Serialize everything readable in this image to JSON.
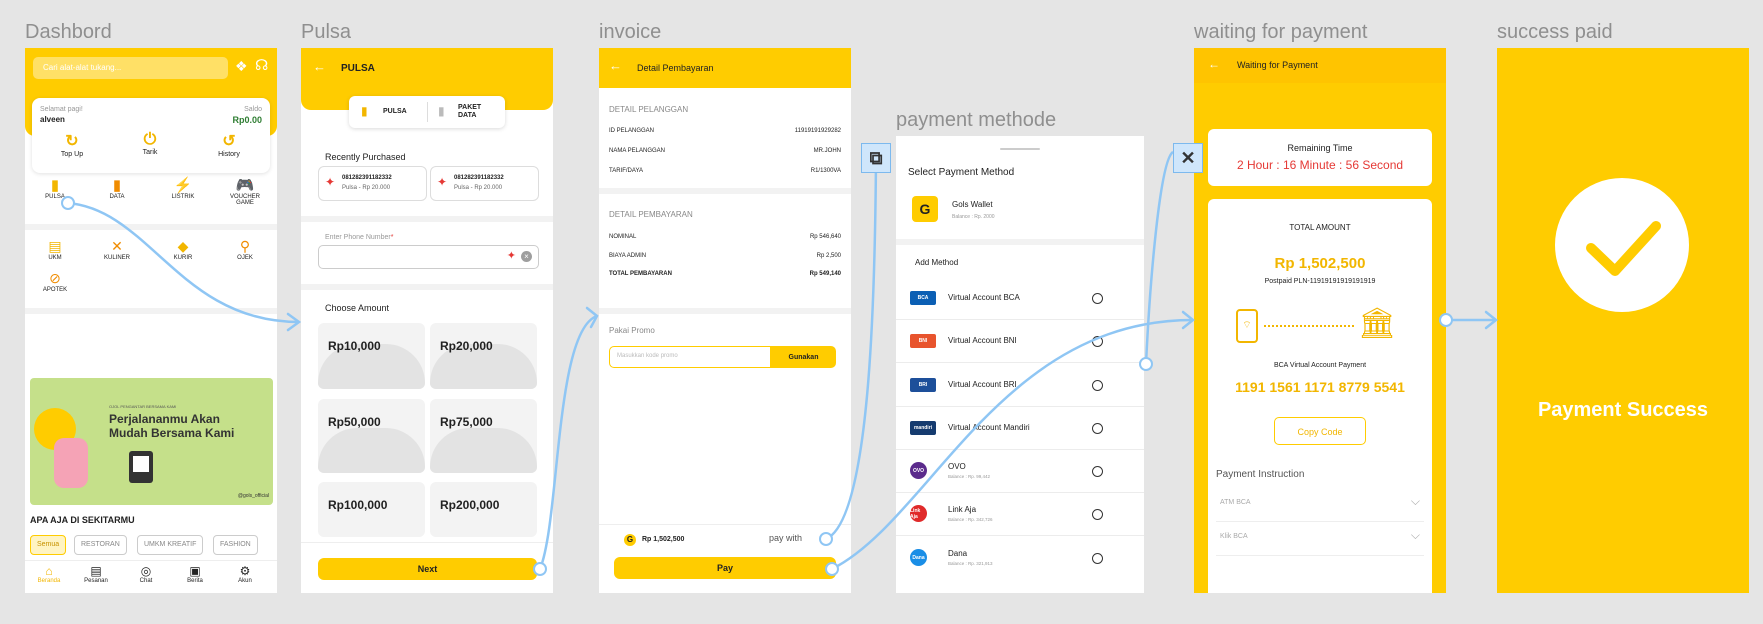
{
  "frames": {
    "dashboard": "Dashbord",
    "pulsa": "Pulsa",
    "invoice": "invoice",
    "payment_method": "payment methode",
    "waiting": "waiting for payment",
    "success": "success paid"
  },
  "dashboard": {
    "search_placeholder": "Cari alat-alat tukang...",
    "greeting": "Selamat pagi!",
    "user": "alveen",
    "saldo_label": "Saldo",
    "saldo_value": "Rp0.00",
    "actions": [
      "Top Up",
      "Tarik",
      "History"
    ],
    "services_row1": [
      "PULSA",
      "DATA",
      "LISTRIK",
      "VOUCHER GAME"
    ],
    "services_row2": [
      "UKM",
      "KULINER",
      "KURIR",
      "OJEK"
    ],
    "services_row3": [
      "APOTEK"
    ],
    "banner_small": "OJOL PENGANTAR BERSAMA KAMI",
    "banner_title": "Perjalananmu Akan Mudah Bersama Kami",
    "banner_handle": "@gols_official",
    "section_title": "APA AJA DI SEKITARMU",
    "chips": [
      "Semua",
      "RESTORAN",
      "UMKM KREATIF",
      "FASHION"
    ],
    "nav": [
      "Beranda",
      "Pesanan",
      "Chat",
      "Berita",
      "Akun"
    ]
  },
  "pulsa": {
    "title": "PULSA",
    "tab_pulsa": "PULSA",
    "tab_paket": "PAKET DATA",
    "recent_title": "Recently Purchased",
    "recent": [
      {
        "number": "081282391182332",
        "desc": "Pulsa - Rp 20.000"
      },
      {
        "number": "081282391182332",
        "desc": "Pulsa - Rp 20.000"
      }
    ],
    "phone_label": "Enter Phone Number",
    "phone_required": "*",
    "amount_title": "Choose Amount",
    "amounts": [
      "Rp10,000",
      "Rp20,000",
      "Rp50,000",
      "Rp75,000",
      "Rp100,000",
      "Rp200,000"
    ],
    "next": "Next"
  },
  "invoice": {
    "title": "Detail Pembayaran",
    "pelanggan_title": "DETAIL PELANGGAN",
    "pelanggan": [
      {
        "k": "ID PELANGGAN",
        "v": "11919191929282"
      },
      {
        "k": "NAMA PELANGGAN",
        "v": "MR.JOHN"
      },
      {
        "k": "TARIF/DAYA",
        "v": "R1/1300VA"
      }
    ],
    "pembayaran_title": "DETAIL PEMBAYARAN",
    "pembayaran": [
      {
        "k": "NOMINAL",
        "v": "Rp 546,640"
      },
      {
        "k": "BIAYA ADMIN",
        "v": "Rp 2,500"
      },
      {
        "k": "TOTAL PEMBAYARAN",
        "v": "Rp 549,140"
      }
    ],
    "promo_title": "Pakai Promo",
    "promo_placeholder": "Masukkan kode promo",
    "promo_button": "Gunakan",
    "total": "Rp 1,502,500",
    "pay_with": "pay with",
    "pay": "Pay"
  },
  "payment": {
    "title": "Select Payment Method",
    "wallet_name": "Gols Wallet",
    "wallet_balance": "Balance : Rp. 2000",
    "add_method": "Add Method",
    "methods": [
      {
        "name": "Virtual Account BCA",
        "logo": "BCA",
        "color": "#0b5fb4",
        "sub": ""
      },
      {
        "name": "Virtual Account BNI",
        "logo": "BNI",
        "color": "#e8542d",
        "sub": ""
      },
      {
        "name": "Virtual Account  BRI",
        "logo": "BRI",
        "color": "#1d4f9a",
        "sub": ""
      },
      {
        "name": "Virtual Account Mandiri",
        "logo": "mandiri",
        "color": "#153b6f",
        "sub": ""
      },
      {
        "name": "OVO",
        "logo": "OVO",
        "color": "#5b2b8c",
        "sub": "Balance : Rp. 99,442"
      },
      {
        "name": "Link Aja",
        "logo": "Link Aja",
        "color": "#e02a2a",
        "sub": "Balance : Rp. 342,726"
      },
      {
        "name": "Dana",
        "logo": "Dana",
        "color": "#1a8ee6",
        "sub": "Balance : Rp. 321,913"
      }
    ]
  },
  "waiting": {
    "title": "Waiting for Payment",
    "remaining_label": "Remaining Time",
    "remaining_value": "2 Hour : 16 Minute : 56 Second",
    "total_label": "TOTAL AMOUNT",
    "total_value": "Rp 1,502,500",
    "postpaid": "Postpaid PLN-11919191919191919",
    "va_label": "BCA Virtual Account Payment",
    "va_number": "1191 1561 1171 8779 5541",
    "copy": "Copy Code",
    "instruction": "Payment Instruction",
    "instructions": [
      "ATM BCA",
      "Klik BCA"
    ]
  },
  "success": {
    "text": "Payment Success"
  },
  "colors": {
    "accent": "#ffcc00",
    "connector": "#8fc6f4",
    "timer": "#e53935",
    "amount": "#f2b600",
    "saldo": "#2e7d32"
  }
}
